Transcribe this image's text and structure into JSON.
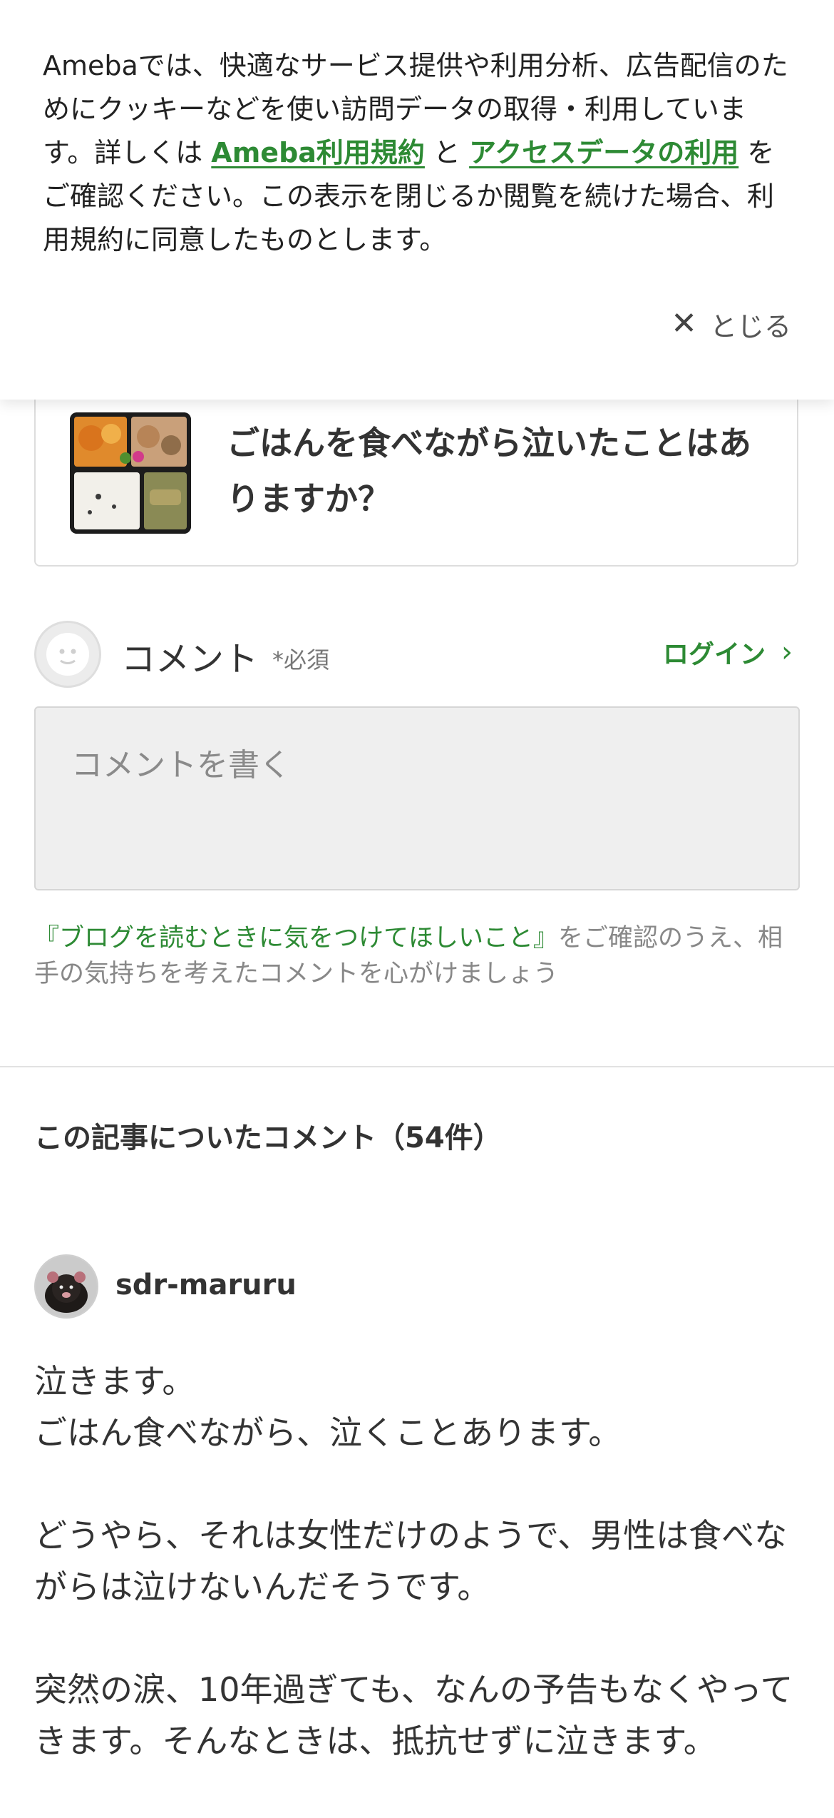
{
  "cookie_banner": {
    "text_part1": "Amebaでは、快適なサービス提供や利用分析、広告配信のためにクッキーなどを使い訪問データの取得・利用しています。詳しくは",
    "link1": "Ameba利用規約",
    "text_part2": "と",
    "link2": "アクセスデータの利用",
    "text_part3": "をご確認ください。この表示を閉じるか閲覧を続けた場合、利用規約に同意したものとします。",
    "close_label": "とじる"
  },
  "article": {
    "title": "ごはんを食べながら泣いたことはありますか？"
  },
  "comment_form": {
    "label": "コメント",
    "required": "*必須",
    "login": "ログイン",
    "placeholder": "コメントを書く",
    "guideline_link": "『ブログを読むときに気をつけてほしいこと』",
    "guideline_text": "をご確認のうえ、相手の気持ちを考えたコメントを心がけましょう"
  },
  "comments": {
    "heading": "この記事についたコメント（54件）",
    "items": [
      {
        "author": "sdr-maruru",
        "paragraphs": [
          "泣きます。\nごはん食べながら、泣くことあります。",
          "どうやら、それは女性だけのようで、男性は食べながらは泣けないんだそうです。",
          "突然の涙、10年過ぎても、なんの予告もなくやってきます。そんなときは、抵抗せずに泣きます。"
        ]
      }
    ]
  },
  "colors": {
    "accent_green": "#2d8a34",
    "text": "#333333",
    "muted": "#888888"
  }
}
